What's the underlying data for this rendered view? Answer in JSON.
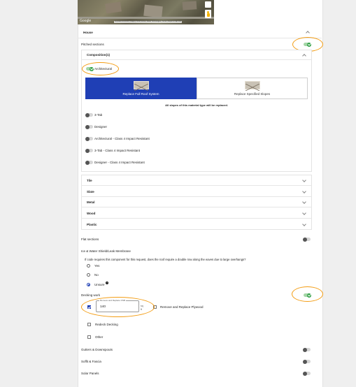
{
  "map": {
    "brand": "Google",
    "footer": "Keyboard shortcuts | Imagery ©2025 Airbus, Maxar Technologies | Terms | Report a map error"
  },
  "house": {
    "title": "House"
  },
  "pitched": {
    "label": "Pitched sections"
  },
  "composition": {
    "label": "Composition(1)"
  },
  "architectural": {
    "label": "Architectural"
  },
  "replace": {
    "full_label": "Replace Full Roof System",
    "specified_label": "Replace Specified Slopes",
    "note": "All slopes of this material type will be replaced."
  },
  "composition_types": [
    {
      "label": "3-Tab"
    },
    {
      "label": "Designer"
    },
    {
      "label": "Architectural - Class 4 Impact Resistant"
    },
    {
      "label": "3-Tab - Class 4 Impact Resistant"
    },
    {
      "label": "Designer - Class 4 Impact Resistant"
    }
  ],
  "materials": [
    {
      "label": "Tile"
    },
    {
      "label": "Slate"
    },
    {
      "label": "Metal"
    },
    {
      "label": "Wood"
    },
    {
      "label": "Plastic"
    }
  ],
  "flat": {
    "label": "Flat sections"
  },
  "ice": {
    "label": "Ice & Water Shield/Leak Membrane",
    "question": "If code requires this component for this request, does the roof require a double row along the eaves due to large overhangs?",
    "options": [
      {
        "label": "Yes"
      },
      {
        "label": "No"
      },
      {
        "label": "Unsure"
      }
    ],
    "info_glyph": "?"
  },
  "decking": {
    "label": "Decking work",
    "field_label": "Remove and Replace OSB",
    "field_value": "140",
    "unit_line1": "sq",
    "unit_line2": "ft",
    "plywood_label": "Remove and Replace Plywood",
    "redeck_label": "Redeck Decking",
    "other_label": "Other"
  },
  "bottom_items": [
    {
      "label": "Gutters & Downspouts"
    },
    {
      "label": "Soffit & Fascia"
    },
    {
      "label": "Solar Panels"
    }
  ],
  "colors": {
    "accent_blue": "#1f3fb5",
    "highlight_orange": "#f39c12",
    "toggle_green": "#2e9e44"
  }
}
